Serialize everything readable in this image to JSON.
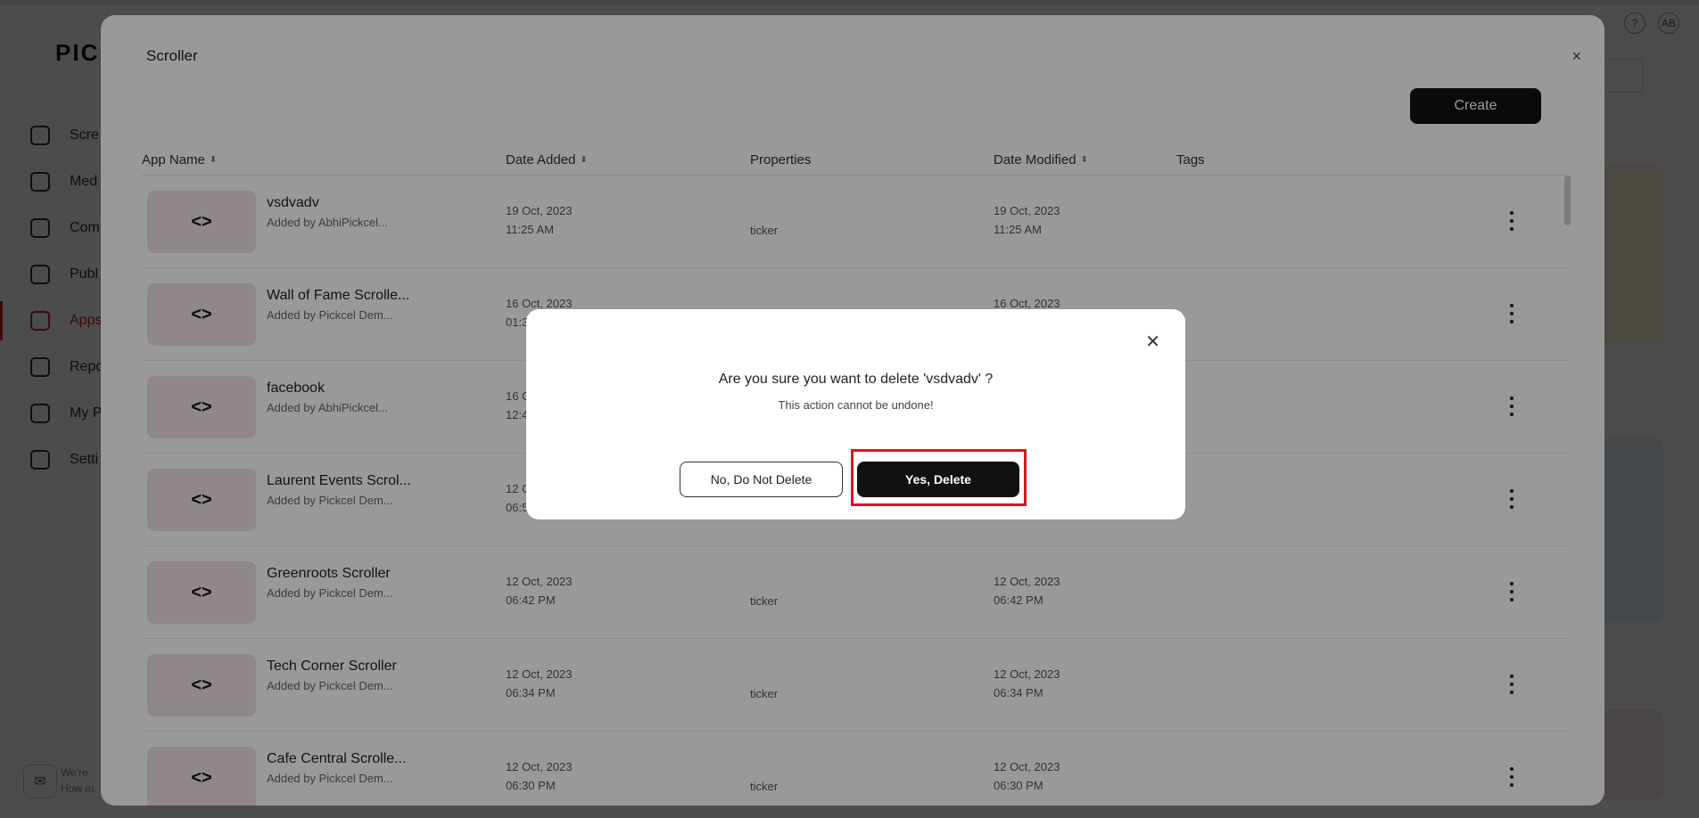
{
  "background": {
    "logo": "PICK",
    "nav": [
      {
        "label": "Scre",
        "active": false
      },
      {
        "label": "Med",
        "active": false
      },
      {
        "label": "Com",
        "active": false
      },
      {
        "label": "Publ",
        "active": false
      },
      {
        "label": "Apps",
        "active": true
      },
      {
        "label": "Repo",
        "active": false
      },
      {
        "label": "My P",
        "active": false
      },
      {
        "label": "Setti",
        "active": false
      }
    ],
    "help_label": "?",
    "avatar_initials": "AB",
    "chat_text": {
      "line1": "We're",
      "line2": "How m"
    }
  },
  "modal": {
    "title": "Scroller",
    "close_icon": "×",
    "create_label": "Create",
    "columns": {
      "app_name": "App Name",
      "date_added": "Date Added",
      "properties": "Properties",
      "date_modified": "Date Modified",
      "tags": "Tags"
    },
    "sort_glyph": "⬍",
    "thumb_glyph": "<>",
    "rows": [
      {
        "name": "vsdvadv",
        "added_by": "Added by AbhiPickcel...",
        "date_added": "19 Oct, 2023",
        "time_added": "11:25 AM",
        "property": "ticker",
        "date_modified": "19 Oct, 2023",
        "time_modified": "11:25 AM"
      },
      {
        "name": "Wall of Fame Scrolle...",
        "added_by": "Added by Pickcel Dem...",
        "date_added": "16 Oct, 2023",
        "time_added": "01:3",
        "property": "",
        "date_modified": "16 Oct, 2023",
        "time_modified": ""
      },
      {
        "name": "facebook",
        "added_by": "Added by AbhiPickcel...",
        "date_added": "16 O",
        "time_added": "12:4",
        "property": "",
        "date_modified": "",
        "time_modified": ""
      },
      {
        "name": "Laurent Events Scrol...",
        "added_by": "Added by Pickcel Dem...",
        "date_added": "12 O",
        "time_added": "06:5",
        "property": "",
        "date_modified": "",
        "time_modified": ""
      },
      {
        "name": "Greenroots Scroller",
        "added_by": "Added by Pickcel Dem...",
        "date_added": "12 Oct, 2023",
        "time_added": "06:42 PM",
        "property": "ticker",
        "date_modified": "12 Oct, 2023",
        "time_modified": "06:42 PM"
      },
      {
        "name": "Tech Corner Scroller",
        "added_by": "Added by Pickcel Dem...",
        "date_added": "12 Oct, 2023",
        "time_added": "06:34 PM",
        "property": "ticker",
        "date_modified": "12 Oct, 2023",
        "time_modified": "06:34 PM"
      },
      {
        "name": "Cafe Central Scrolle...",
        "added_by": "Added by Pickcel Dem...",
        "date_added": "12 Oct, 2023",
        "time_added": "06:30 PM",
        "property": "ticker",
        "date_modified": "12 Oct, 2023",
        "time_modified": "06:30 PM"
      }
    ]
  },
  "confirm": {
    "close_icon": "✕",
    "question": "Are you sure you want to delete 'vsdvadv' ?",
    "warning": "This action cannot be undone!",
    "no_label": "No, Do Not Delete",
    "yes_label": "Yes, Delete",
    "highlight_color": "#e0121c"
  }
}
